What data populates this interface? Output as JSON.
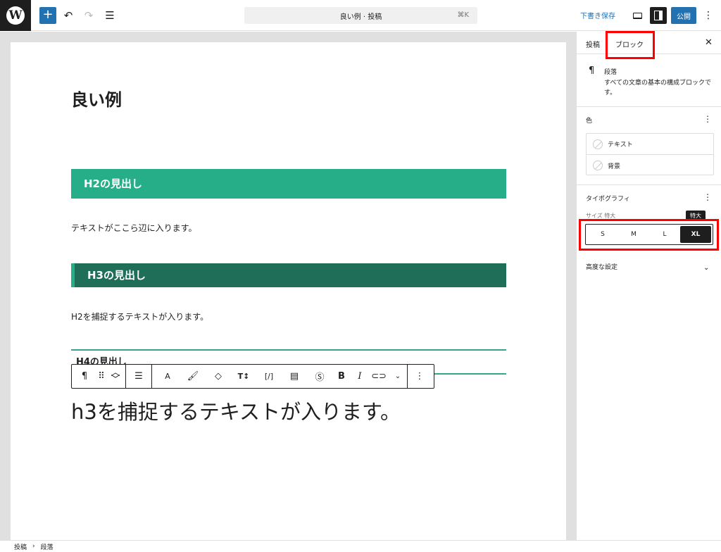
{
  "topbar": {
    "document_title": "良い例 · 投稿",
    "shortcut": "⌘K",
    "save_draft": "下書き保存",
    "publish": "公開"
  },
  "editor": {
    "post_title": "良い例",
    "h2": "H2の見出し",
    "para1": "テキストがここら辺に入ります。",
    "h3": "H3の見出し",
    "para2": "H2を捕捉するテキストが入ります。",
    "h4": "H4の見出し",
    "big_para": "h3を捕捉するテキストが入ります。"
  },
  "block_toolbar": {
    "text_color_label": "A",
    "bold_label": "B",
    "italic_label": "I"
  },
  "sidebar": {
    "tab_post": "投稿",
    "tab_block": "ブロック",
    "block_name": "段落",
    "block_description": "すべての文章の基本の構成ブロックです。",
    "color_section": "色",
    "color_text": "テキスト",
    "color_background": "背景",
    "typography_section": "タイポグラフィ",
    "size_label": "サイズ 特大",
    "tooltip": "特大",
    "sizes": [
      "S",
      "M",
      "L",
      "XL"
    ],
    "selected_size": "XL",
    "advanced": "高度な設定"
  },
  "breadcrumb": {
    "root": "投稿",
    "separator": "›",
    "current": "段落"
  }
}
